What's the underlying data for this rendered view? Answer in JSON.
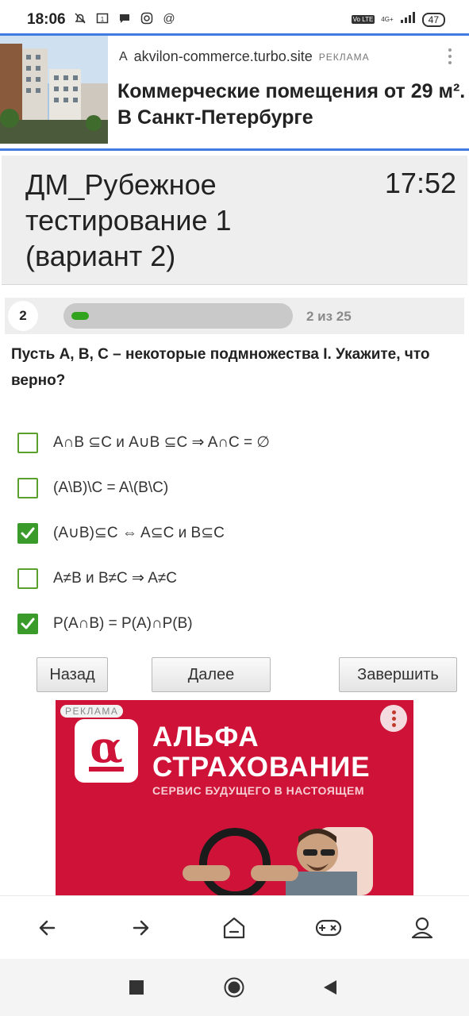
{
  "status_bar": {
    "time": "18:06",
    "network": "4G+",
    "lte": "Vo LTE",
    "battery": "47"
  },
  "top_ad": {
    "domain": "akvilon-commerce.turbo.site",
    "ad_tag": "РЕКЛАМА",
    "title": "Коммерческие помещения от 29 м². В Санкт-Петербурге",
    "icon": "adchoices-icon"
  },
  "test": {
    "title": "ДМ_Рубежное тестирование 1 (вариант 2)",
    "timer": "17:52"
  },
  "progress": {
    "question_number": "2",
    "counter": "2 из 25",
    "fraction": 0.08
  },
  "question": {
    "text": "Пусть A, B, C – некоторые подмножества I. Укажите, что верно?"
  },
  "options": [
    {
      "label": "A∩B ⊆C и A∪B ⊆C ⇒ A∩C = ∅",
      "checked": false
    },
    {
      "label": "(A\\B)\\C = A\\(B\\C)",
      "checked": false
    },
    {
      "label": "(A∪B)⊆C ⇔ A⊆C и B⊆C",
      "checked": true
    },
    {
      "label": "A≠B и B≠C ⇒ A≠C",
      "checked": false
    },
    {
      "label": "P(A∩B) = P(A)∩P(B)",
      "checked": true
    }
  ],
  "buttons": {
    "back": "Назад",
    "next": "Далее",
    "finish": "Завершить"
  },
  "bottom_ad": {
    "badge": "РЕКЛАМА",
    "brand_line1": "АЛЬФА",
    "brand_line2": "СТРАХОВАНИЕ",
    "slogan": "СЕРВИС БУДУЩЕГО В НАСТОЯЩЕМ",
    "logo_letter": "α",
    "brand_color": "#cf1338"
  },
  "browser_nav": [
    "back-arrow-icon",
    "forward-arrow-icon",
    "home-icon",
    "games-icon",
    "profile-icon"
  ],
  "system_nav": [
    "recents-icon",
    "home-circle-icon",
    "back-triangle-icon"
  ]
}
